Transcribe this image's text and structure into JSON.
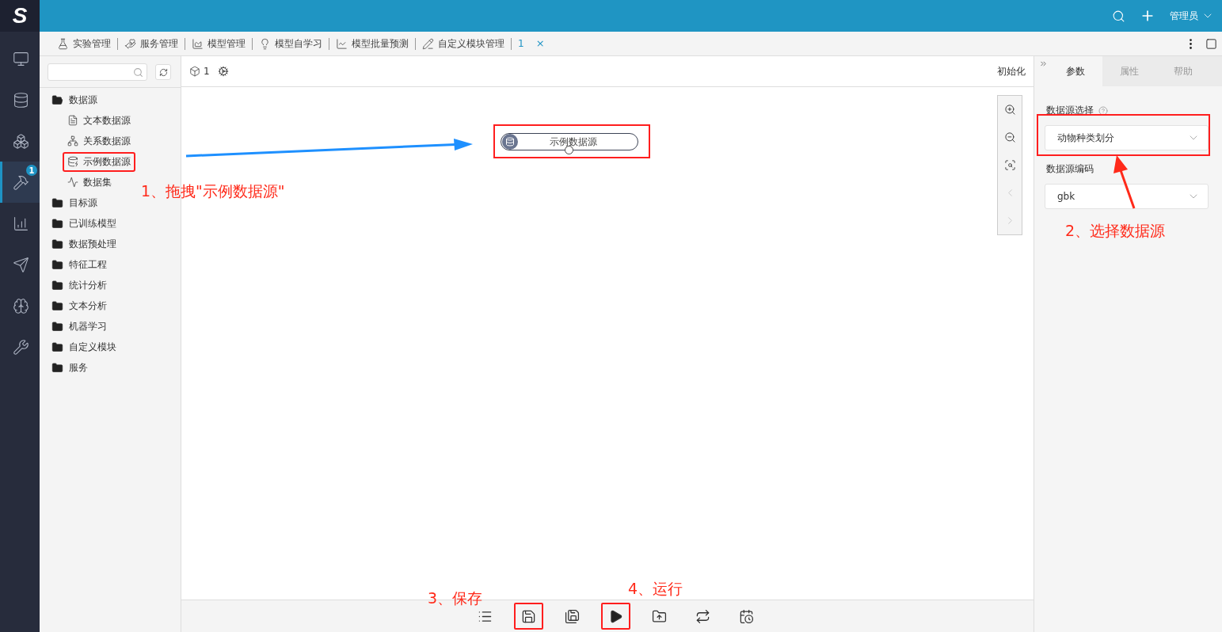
{
  "logo": "S",
  "top_bar": {
    "user": "管理员"
  },
  "side_rail": [
    {
      "selected": false
    },
    {
      "selected": false
    },
    {
      "selected": false
    },
    {
      "selected": true,
      "badge": "1"
    },
    {
      "selected": false
    },
    {
      "selected": false
    },
    {
      "selected": false
    },
    {
      "selected": false
    }
  ],
  "tabs": [
    {
      "label": "实验管理",
      "selected": false
    },
    {
      "label": "服务管理",
      "selected": false
    },
    {
      "label": "模型管理",
      "selected": false
    },
    {
      "label": "模型自学习",
      "selected": false
    },
    {
      "label": "模型批量预测",
      "selected": false
    },
    {
      "label": "自定义模块管理",
      "selected": false
    },
    {
      "label": "1",
      "selected": true,
      "close": "×"
    }
  ],
  "tree": [
    {
      "label": "数据源",
      "expanded": true,
      "children": [
        {
          "label": "文本数据源",
          "highlighted": false
        },
        {
          "label": "关系数据源",
          "highlighted": false
        },
        {
          "label": "示例数据源",
          "highlighted": true
        },
        {
          "label": "数据集",
          "highlighted": false
        }
      ]
    },
    {
      "label": "目标源",
      "expanded": false
    },
    {
      "label": "已训练模型",
      "expanded": false
    },
    {
      "label": "数据预处理",
      "expanded": false
    },
    {
      "label": "特征工程",
      "expanded": false
    },
    {
      "label": "统计分析",
      "expanded": false
    },
    {
      "label": "文本分析",
      "expanded": false
    },
    {
      "label": "机器学习",
      "expanded": false
    },
    {
      "label": "自定义模块",
      "expanded": false
    },
    {
      "label": "服务",
      "expanded": false
    }
  ],
  "canvas": {
    "experiment_id": "1",
    "init_button": "初始化",
    "node": {
      "label": "示例数据源",
      "highlighted": true
    },
    "zoom_tools": [
      {
        "disabled": false
      },
      {
        "disabled": false
      },
      {
        "disabled": false
      },
      {
        "disabled": true
      },
      {
        "disabled": true
      }
    ]
  },
  "bottom_toolbar": [
    {
      "highlighted": false
    },
    {
      "highlighted": true
    },
    {
      "highlighted": false
    },
    {
      "highlighted": true
    },
    {
      "highlighted": false
    },
    {
      "highlighted": false
    },
    {
      "highlighted": false
    }
  ],
  "right_panel": {
    "tabs": [
      {
        "label": "参数",
        "selected": true
      },
      {
        "label": "属性",
        "selected": false
      },
      {
        "label": "帮助",
        "selected": false
      }
    ],
    "fields": [
      {
        "label": "数据源选择",
        "help": true,
        "value": "动物种类划分",
        "highlighted": true
      },
      {
        "label": "数据源编码",
        "help": false,
        "value": "gbk",
        "highlighted": false
      }
    ]
  },
  "annotations": [
    {
      "text": "1、拖拽\"示例数据源\""
    },
    {
      "text": "2、选择数据源"
    },
    {
      "text": "3、保存"
    },
    {
      "text": "4、运行"
    }
  ]
}
